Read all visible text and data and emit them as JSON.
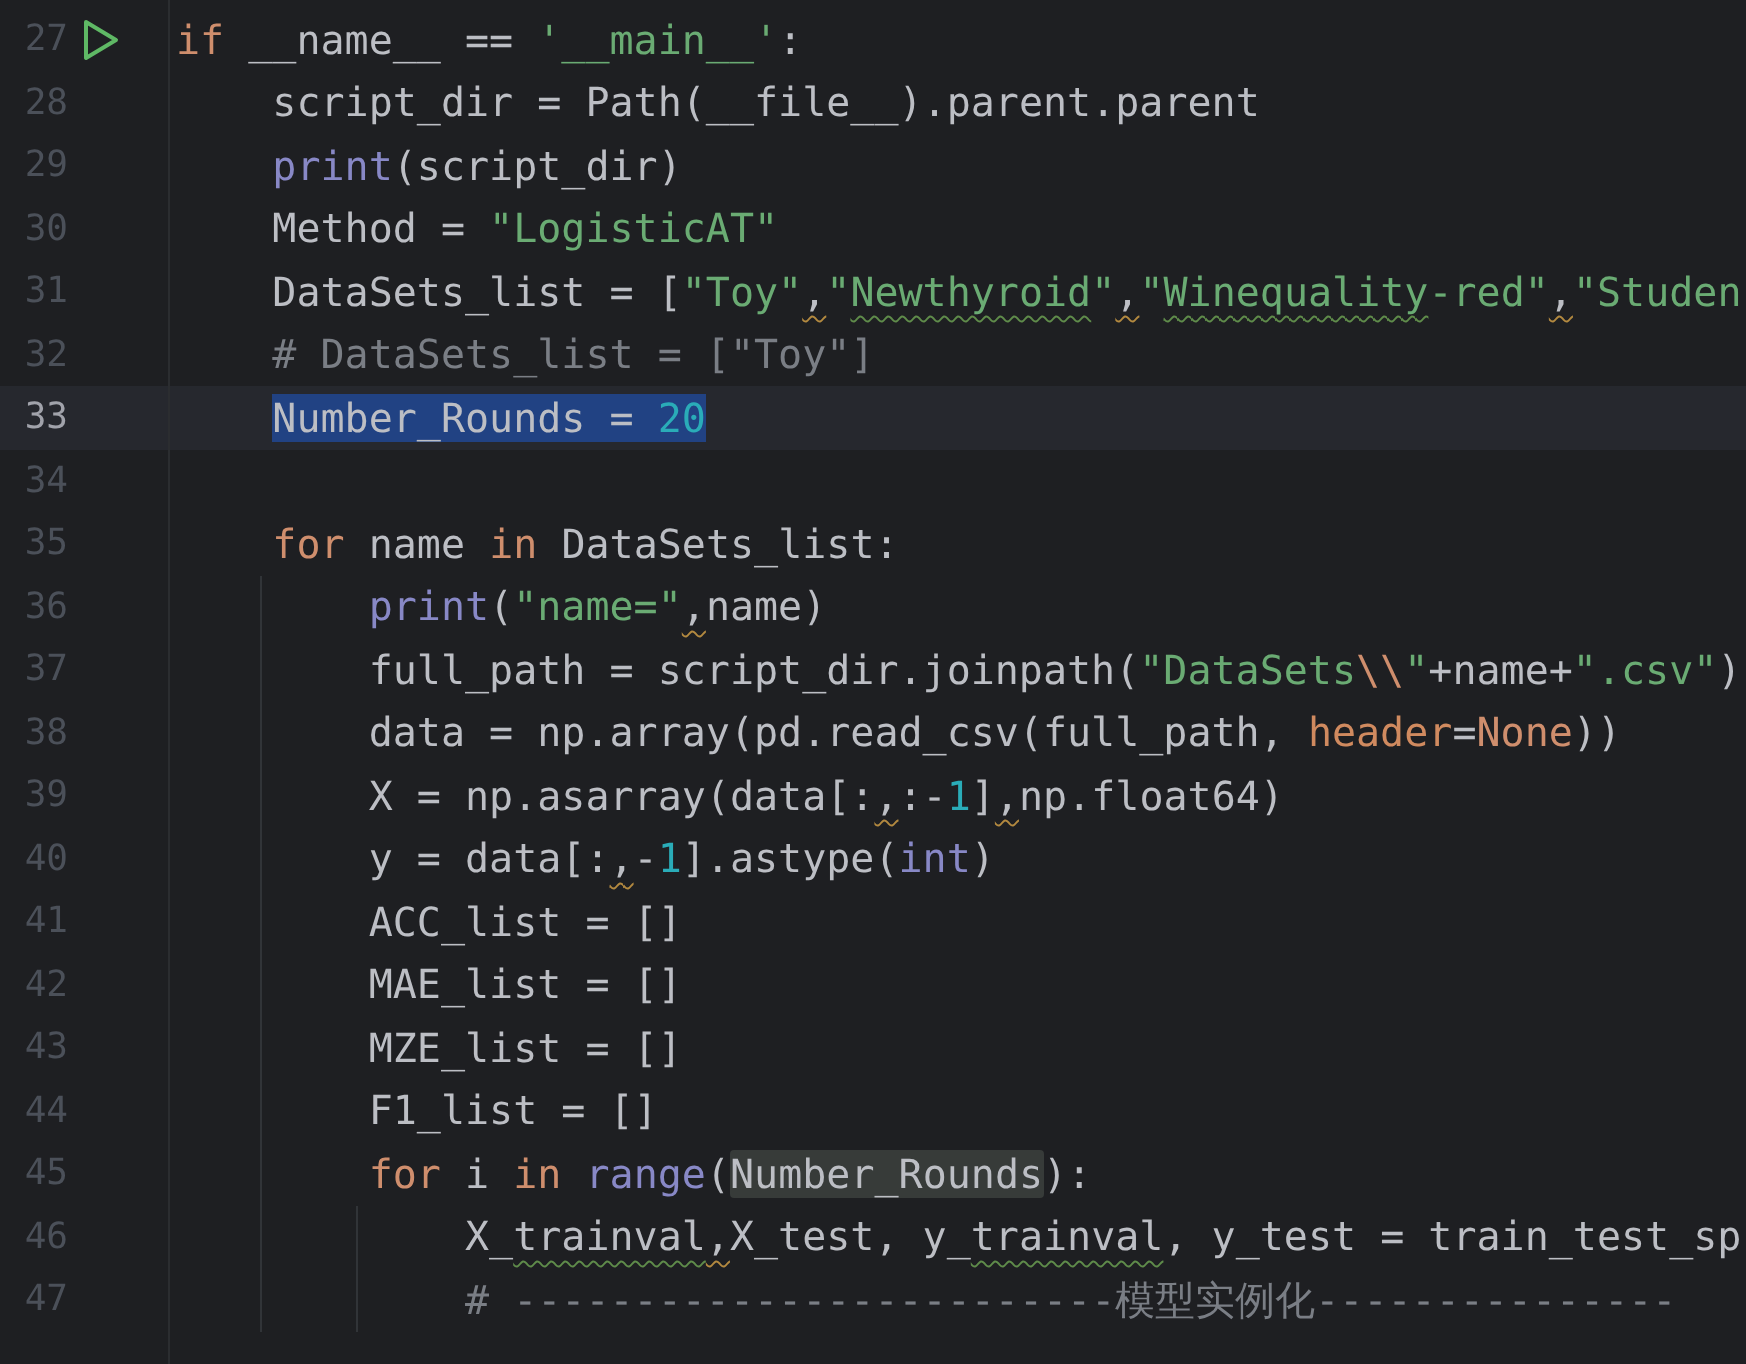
{
  "lines": [
    {
      "number": "27",
      "run": true,
      "current": false,
      "tokens": [
        {
          "kind": "keyword",
          "text": "if"
        },
        {
          "kind": "plain",
          "text": " __name__ == "
        },
        {
          "kind": "string",
          "text": "'__main__'"
        },
        {
          "kind": "plain",
          "text": ":"
        }
      ]
    },
    {
      "number": "28",
      "current": false,
      "tokens": [
        {
          "kind": "plain",
          "text": "    script_dir = Path(__file__).parent.parent"
        }
      ]
    },
    {
      "number": "29",
      "current": false,
      "tokens": [
        {
          "kind": "builtin",
          "text": "    print"
        },
        {
          "kind": "plain",
          "text": "(script_dir)"
        }
      ]
    },
    {
      "number": "30",
      "current": false,
      "tokens": [
        {
          "kind": "plain",
          "text": "    Method = "
        },
        {
          "kind": "string",
          "text": "\"LogisticAT\""
        }
      ]
    },
    {
      "number": "31",
      "current": false,
      "tokens": [
        {
          "kind": "plain",
          "text": "    DataSets_list = ["
        },
        {
          "kind": "string",
          "text": "\"Toy\""
        },
        {
          "kind": "plain",
          "text": ",",
          "warn": true
        },
        {
          "kind": "string",
          "text": "\""
        },
        {
          "kind": "string",
          "text": "Newthyroid",
          "typo": true
        },
        {
          "kind": "string",
          "text": "\""
        },
        {
          "kind": "plain",
          "text": ",",
          "warn": true
        },
        {
          "kind": "string",
          "text": "\""
        },
        {
          "kind": "string",
          "text": "Winequality",
          "typo": true
        },
        {
          "kind": "string",
          "text": "-red\""
        },
        {
          "kind": "plain",
          "text": ",",
          "warn": true
        },
        {
          "kind": "string",
          "text": "\"Studen"
        }
      ]
    },
    {
      "number": "32",
      "current": false,
      "tokens": [
        {
          "kind": "comment",
          "text": "    # DataSets_list = [\"Toy\"]"
        }
      ]
    },
    {
      "number": "33",
      "current": true,
      "tokens": [
        {
          "kind": "plain",
          "text": "    Number_Rounds = ",
          "selected": true
        },
        {
          "kind": "number",
          "text": "20",
          "selected": true
        }
      ]
    },
    {
      "number": "34",
      "current": false
    },
    {
      "number": "35",
      "current": false,
      "tokens": [
        {
          "kind": "keyword",
          "text": "    for"
        },
        {
          "kind": "plain",
          "text": " name "
        },
        {
          "kind": "keyword",
          "text": "in"
        },
        {
          "kind": "plain",
          "text": " DataSets_list:"
        }
      ]
    },
    {
      "number": "36",
      "current": false,
      "tokens": [
        {
          "kind": "builtin",
          "text": "        print"
        },
        {
          "kind": "plain",
          "text": "("
        },
        {
          "kind": "string",
          "text": "\"name=\""
        },
        {
          "kind": "plain",
          "text": ",",
          "warn": true
        },
        {
          "kind": "plain",
          "text": "name)"
        }
      ]
    },
    {
      "number": "37",
      "current": false,
      "tokens": [
        {
          "kind": "plain",
          "text": "        full_path = script_dir.joinpath("
        },
        {
          "kind": "string",
          "text": "\"DataSets"
        },
        {
          "kind": "escape",
          "text": "\\\\"
        },
        {
          "kind": "string",
          "text": "\""
        },
        {
          "kind": "plain",
          "text": "+name+"
        },
        {
          "kind": "string",
          "text": "\".csv\""
        },
        {
          "kind": "plain",
          "text": ")"
        }
      ]
    },
    {
      "number": "38",
      "current": false,
      "tokens": [
        {
          "kind": "plain",
          "text": "        data = np.array(pd.read_csv(full_path, "
        },
        {
          "kind": "param",
          "text": "header"
        },
        {
          "kind": "plain",
          "text": "="
        },
        {
          "kind": "keyword",
          "text": "None"
        },
        {
          "kind": "plain",
          "text": "))"
        }
      ]
    },
    {
      "number": "39",
      "current": false,
      "tokens": [
        {
          "kind": "plain",
          "text": "        X = np.asarray(data[:"
        },
        {
          "kind": "plain",
          "text": ",",
          "warn": true
        },
        {
          "kind": "plain",
          "text": ":-"
        },
        {
          "kind": "number",
          "text": "1"
        },
        {
          "kind": "plain",
          "text": "]"
        },
        {
          "kind": "plain",
          "text": ",",
          "warn": true
        },
        {
          "kind": "plain",
          "text": "np.float64)"
        }
      ]
    },
    {
      "number": "40",
      "current": false,
      "tokens": [
        {
          "kind": "plain",
          "text": "        y = data[:"
        },
        {
          "kind": "plain",
          "text": ",",
          "warn": true
        },
        {
          "kind": "plain",
          "text": "-"
        },
        {
          "kind": "number",
          "text": "1"
        },
        {
          "kind": "plain",
          "text": "].astype("
        },
        {
          "kind": "builtin",
          "text": "int"
        },
        {
          "kind": "plain",
          "text": ")"
        }
      ]
    },
    {
      "number": "41",
      "current": false,
      "tokens": [
        {
          "kind": "plain",
          "text": "        ACC_list = []"
        }
      ]
    },
    {
      "number": "42",
      "current": false,
      "tokens": [
        {
          "kind": "plain",
          "text": "        MAE_list = []"
        }
      ]
    },
    {
      "number": "43",
      "current": false,
      "tokens": [
        {
          "kind": "plain",
          "text": "        MZE_list = []"
        }
      ]
    },
    {
      "number": "44",
      "current": false,
      "tokens": [
        {
          "kind": "plain",
          "text": "        F1_list = []"
        }
      ]
    },
    {
      "number": "45",
      "current": false,
      "tokens": [
        {
          "kind": "keyword",
          "text": "        for"
        },
        {
          "kind": "plain",
          "text": " i "
        },
        {
          "kind": "keyword",
          "text": "in"
        },
        {
          "kind": "builtin",
          "text": " range"
        },
        {
          "kind": "plain",
          "text": "("
        },
        {
          "kind": "plain",
          "text": "Number_Rounds",
          "highlight": true
        },
        {
          "kind": "plain",
          "text": "):"
        }
      ]
    },
    {
      "number": "46",
      "current": false,
      "tokens": [
        {
          "kind": "plain",
          "text": "            X_"
        },
        {
          "kind": "plain",
          "text": "trainval",
          "typo": true
        },
        {
          "kind": "plain",
          "text": ",",
          "warn": true
        },
        {
          "kind": "plain",
          "text": "X_test, y_"
        },
        {
          "kind": "plain",
          "text": "trainval",
          "typo": true
        },
        {
          "kind": "plain",
          "text": ", y_test = train_test_sp"
        }
      ]
    },
    {
      "number": "47",
      "current": false,
      "tokens": [
        {
          "kind": "comment",
          "text": "            # -------------------------模型实例化---------------"
        }
      ]
    }
  ]
}
